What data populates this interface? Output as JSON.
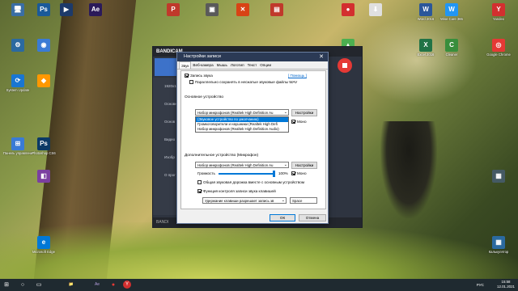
{
  "desktop": {
    "icons": [
      {
        "label": "",
        "glyph": "🖥",
        "color": "#3a6ea5"
      },
      {
        "label": "",
        "glyph": "Ps",
        "color": "#1a5a9a"
      },
      {
        "label": "",
        "glyph": "▶",
        "color": "#1d3a6a"
      },
      {
        "label": "",
        "glyph": "Ae",
        "color": "#2b1a5a"
      },
      {
        "label": "",
        "glyph": "P",
        "color": "#c0392b"
      },
      {
        "label": "",
        "glyph": "▣",
        "color": "#5a5a5a"
      },
      {
        "label": "",
        "glyph": "✕",
        "color": "#d84315"
      },
      {
        "label": "",
        "glyph": "▤",
        "color": "#c0392b"
      },
      {
        "label": "",
        "glyph": "●",
        "color": "#d32f2f"
      },
      {
        "label": "",
        "glyph": "⬇",
        "color": "#e0e0e0"
      },
      {
        "label": "Word 2016",
        "glyph": "W",
        "color": "#2b579a"
      },
      {
        "label": "Wise Care 365",
        "glyph": "W",
        "color": "#2196f3"
      },
      {
        "label": "Yandex",
        "glyph": "Y",
        "color": "#d32f2f"
      },
      {
        "label": "",
        "glyph": "⚙",
        "color": "#2b6aa0"
      },
      {
        "label": "",
        "glyph": "◉",
        "color": "#3a7bd5"
      },
      {
        "label": "Excel 2016",
        "glyph": "X",
        "color": "#217346"
      },
      {
        "label": "Cleaner",
        "glyph": "C",
        "color": "#388e3c"
      },
      {
        "label": "Google Chrome",
        "glyph": "◎",
        "color": "#e53935"
      },
      {
        "label": "System Update",
        "glyph": "⟳",
        "color": "#1976d2"
      },
      {
        "label": "",
        "glyph": "◆",
        "color": "#ff9800"
      },
      {
        "label": "",
        "glyph": "▲",
        "color": "#4caf50"
      },
      {
        "label": "Панель управления",
        "glyph": "⊞",
        "color": "#3a7bd5"
      },
      {
        "label": "Photoshop CS6",
        "glyph": "Ps",
        "color": "#0b3a66"
      },
      {
        "label": "",
        "glyph": "◧",
        "color": "#7b3fa0"
      },
      {
        "label": "",
        "glyph": "▦",
        "color": "#455a64"
      },
      {
        "label": "Калькулятор",
        "glyph": "▦",
        "color": "#2b6aa0"
      },
      {
        "label": "Microsoft Edge",
        "glyph": "e",
        "color": "#0078d7"
      }
    ]
  },
  "bandicam": {
    "logo": "BANDICAM",
    "resolution": "1920x1080",
    "side_items": [
      "Основное",
      "Основ",
      "Видео",
      "Изобр",
      "О прог"
    ],
    "bottom_text": "BANDI"
  },
  "dialog": {
    "title": "Настройки записи",
    "close_glyph": "✕",
    "tabs": [
      "Звук",
      "Веб-камера",
      "Мышь",
      "Логотип",
      "Текст",
      "Опции"
    ],
    "record_sound_label": "Запись звука",
    "help_link": "[ Помощь ]",
    "parallel_wav_label": "Параллельно сохранять в несжатые звуковые файлы WAV",
    "main_device_label": "Основное устройство",
    "main_device_value": "Набор микрофонов (Realtek High Definition Au",
    "settings_button": "Настройки",
    "mono_label": "Моно",
    "dropdown_options": [
      "(Звуковое устройство по умолчанию)",
      "Громкоговорители и наушники (Realtek High Defi",
      "Набор микрофонов (Realtek High Definition Audio)"
    ],
    "dropdown_selected_index": 0,
    "extra_device_label": "Дополнительное устройство (Микрофон)",
    "extra_device_value": "Набор микрофонов (Realtek High Definition Au",
    "volume_label": "Громкость",
    "volume_value": "100%",
    "volume_fraction": 1.0,
    "common_track_label": "Общая звуковая дорожка вместе с основным устройством",
    "hotkey_function_label": "Функция контроля записи звука клавишей",
    "hotkey_mode_value": "Удержание клавиши разрешает запись зв",
    "hotkey_key_value": "Space",
    "ok_button": "ОК",
    "cancel_button": "Отмена"
  },
  "taskbar": {
    "start_glyph": "⊞",
    "search_glyph": "○",
    "taskview_glyph": "▭",
    "explorer_glyph": "📁",
    "app_glyphs": [
      "Ae",
      "●",
      "Y"
    ],
    "language": "РУС",
    "time": "15:58",
    "date": "12.01.2021"
  }
}
